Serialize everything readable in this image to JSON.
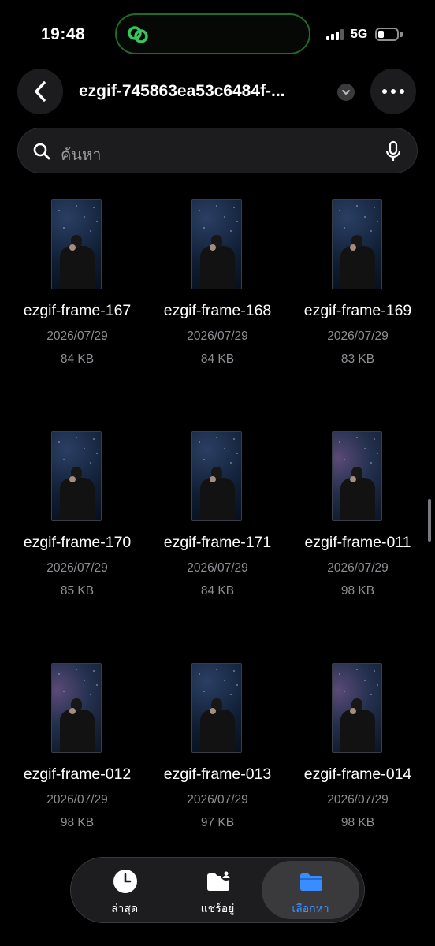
{
  "status_bar": {
    "time": "19:48",
    "network": "5G",
    "battery_level": 0.3
  },
  "nav": {
    "title": "ezgif-745863ea53c6484f-..."
  },
  "search": {
    "placeholder": "ค้นหา"
  },
  "files": [
    {
      "name": "ezgif-frame-167",
      "date": "2026/07/29",
      "size": "84 KB"
    },
    {
      "name": "ezgif-frame-168",
      "date": "2026/07/29",
      "size": "84 KB"
    },
    {
      "name": "ezgif-frame-169",
      "date": "2026/07/29",
      "size": "83 KB"
    },
    {
      "name": "ezgif-frame-170",
      "date": "2026/07/29",
      "size": "85 KB"
    },
    {
      "name": "ezgif-frame-171",
      "date": "2026/07/29",
      "size": "84 KB"
    },
    {
      "name": "ezgif-frame-011",
      "date": "2026/07/29",
      "size": "98 KB"
    },
    {
      "name": "ezgif-frame-012",
      "date": "2026/07/29",
      "size": "98 KB"
    },
    {
      "name": "ezgif-frame-013",
      "date": "2026/07/29",
      "size": "97 KB"
    },
    {
      "name": "ezgif-frame-014",
      "date": "2026/07/29",
      "size": "98 KB"
    }
  ],
  "tabbar": {
    "recents": "ล่าสุด",
    "shared": "แชร์อยู่",
    "browse": "เลือกหา"
  },
  "colors": {
    "accent": "#3a8dff",
    "island_border": "#1f6b2a"
  }
}
